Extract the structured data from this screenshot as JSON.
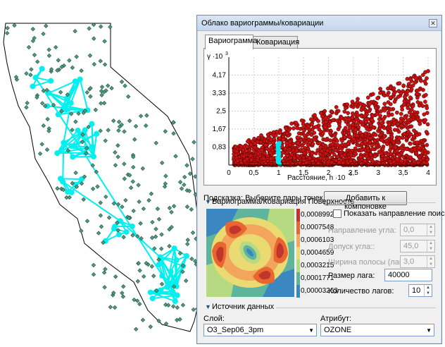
{
  "window": {
    "title": "Облако вариограммы/ковариации",
    "close_label": "✕"
  },
  "tabs": [
    {
      "label": "Вариограмма",
      "active": true
    },
    {
      "label": "Ковариация",
      "active": false
    }
  ],
  "hint": {
    "label": "Подсказка: Выберите пары точек,",
    "button": "Добавить к компоновке"
  },
  "surface_section": {
    "title": "Вариограмма/Ковариация Поверхность"
  },
  "legend": [
    {
      "value": "0,0008992",
      "color": "#c1352c"
    },
    {
      "value": "0,0007548",
      "color": "#e8662f"
    },
    {
      "value": "0,0006103",
      "color": "#f3a55b"
    },
    {
      "value": "0,0004659",
      "color": "#eada72"
    },
    {
      "value": "0,0003215",
      "color": "#b5da81"
    },
    {
      "value": "0,0001771",
      "color": "#60b49c"
    },
    {
      "value": "0,00003263",
      "color": "#3a87c2"
    }
  ],
  "options": {
    "show_direction": {
      "label": "Показать направление поиска",
      "checked": false
    },
    "angle_direction": {
      "label": "Направление угла:",
      "value": "0,0",
      "enabled": false
    },
    "angle_tolerance": {
      "label": "Допуск угла::",
      "value": "45,0",
      "enabled": false
    },
    "bandwidth": {
      "label": "Ширина полосы (лаги):",
      "value": "3,0",
      "enabled": false
    },
    "lag_size": {
      "label": "Размер лага:",
      "value": "40000"
    },
    "lag_count": {
      "label": "Количество лагов:",
      "value": "10"
    }
  },
  "data_source": {
    "title": "Источник данных",
    "layer_label": "Слой:",
    "layer_value": "O3_Sep06_3pm",
    "attribute_label": "Атрибут:",
    "attribute_value": "OZONE"
  },
  "chart_data": {
    "type": "scatter",
    "ylabel": "γ ·10",
    "ylabel_exp": "3",
    "xlabel": "Расстояние, h ·10",
    "xlabel_exp": "-5",
    "xlim": [
      0,
      4
    ],
    "ylim": [
      0,
      5
    ],
    "x_ticks": [
      "0",
      "0,5",
      "1",
      "1,5",
      "2",
      "2,5",
      "3",
      "3,5",
      "4"
    ],
    "y_ticks": [
      "0,83",
      "1,67",
      "2,5",
      "3,33",
      "4,17"
    ],
    "series": [
      {
        "color": "#cc1111",
        "x_range": [
          0.1,
          4.0
        ],
        "y_range": [
          0,
          4.6
        ],
        "points": 1800
      },
      {
        "color": "#00e5ee",
        "x_range": [
          0.97,
          1.03
        ],
        "y_range": [
          0,
          1.05
        ],
        "points": 60
      }
    ],
    "grid": true
  },
  "map": {
    "colors": {
      "outline": "#000000",
      "points": "#4a9b80",
      "network": "#00f0f0"
    }
  }
}
